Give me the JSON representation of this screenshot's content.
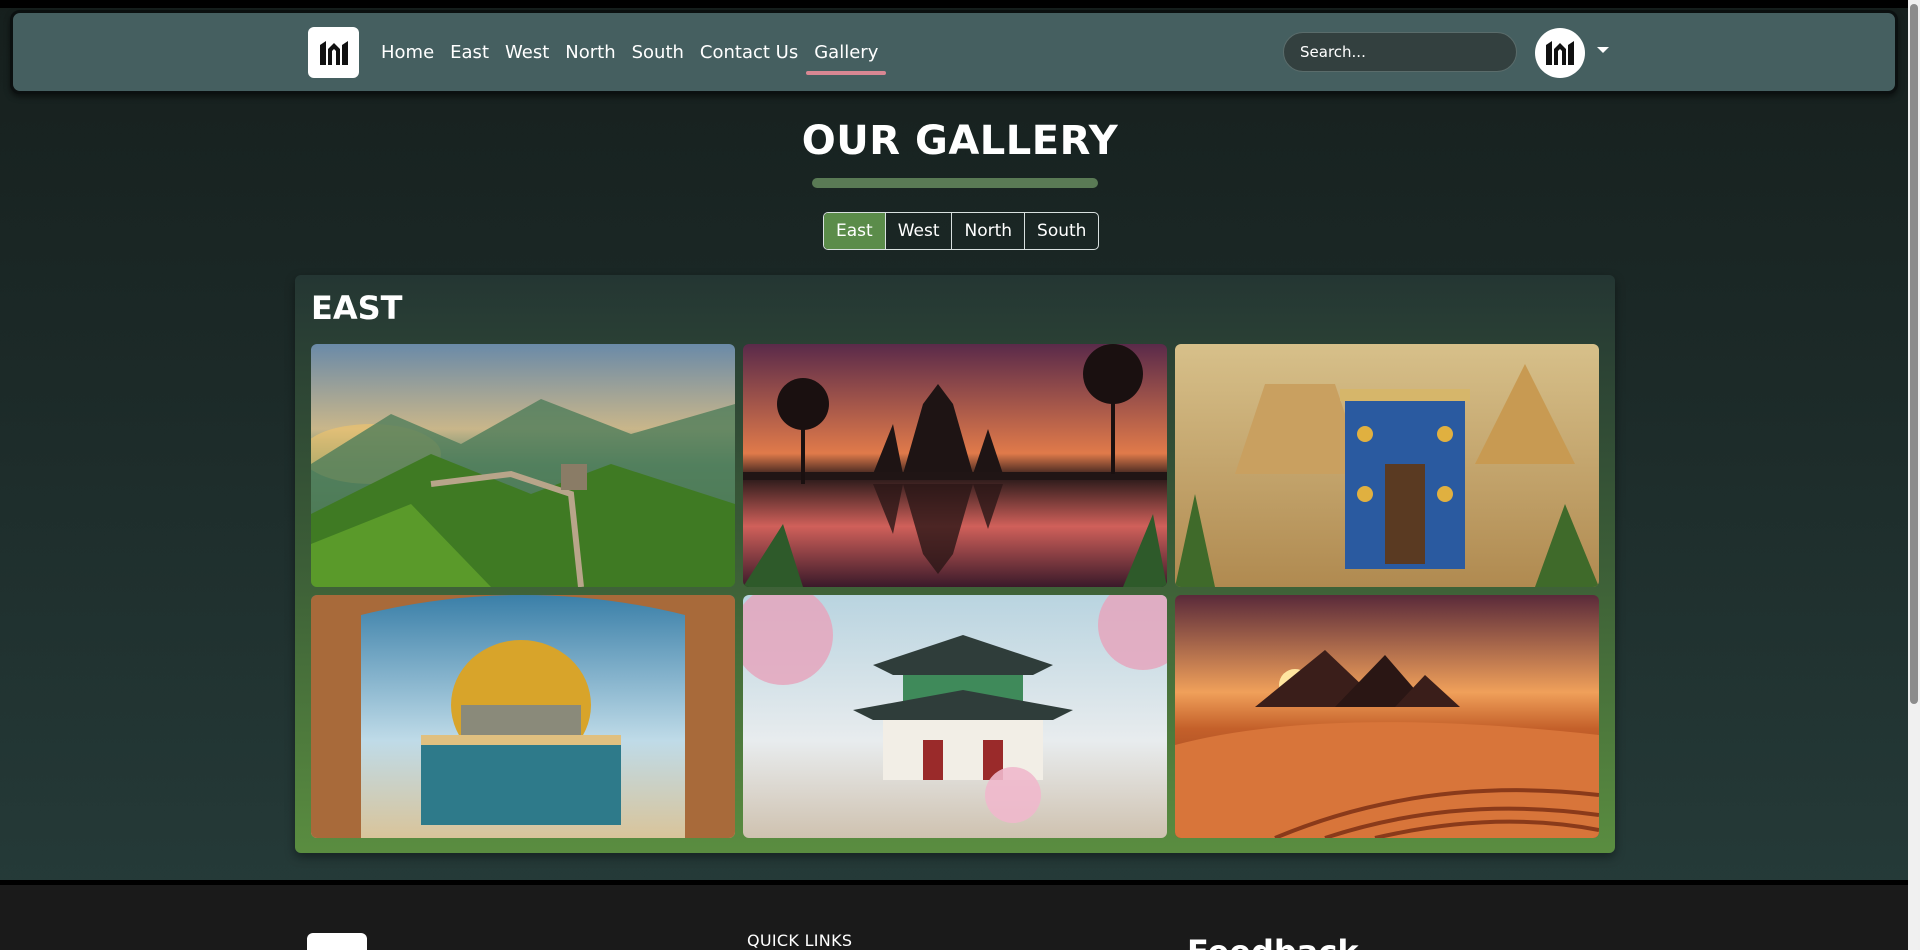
{
  "nav": {
    "links": [
      "Home",
      "East",
      "West",
      "North",
      "South",
      "Contact Us",
      "Gallery"
    ],
    "active": "Gallery",
    "search_placeholder": "Search..."
  },
  "page": {
    "title": "OUR GALLERY",
    "filters": [
      "East",
      "West",
      "North",
      "South"
    ],
    "active_filter": "East"
  },
  "section": {
    "title": "EAST",
    "images": [
      {
        "icon": "great-wall-image"
      },
      {
        "icon": "angkor-wat-image"
      },
      {
        "icon": "babylon-gate-image"
      },
      {
        "icon": "dome-of-the-rock-image"
      },
      {
        "icon": "korean-palace-image"
      },
      {
        "icon": "pyramids-desert-image"
      }
    ]
  },
  "footer": {
    "quick_links": "QUICK LINKS",
    "feedback": "Feedback"
  },
  "colors": {
    "navbar": "#455f60",
    "accent_underline": "#d98793",
    "active_filter": "#5b8c4a"
  }
}
